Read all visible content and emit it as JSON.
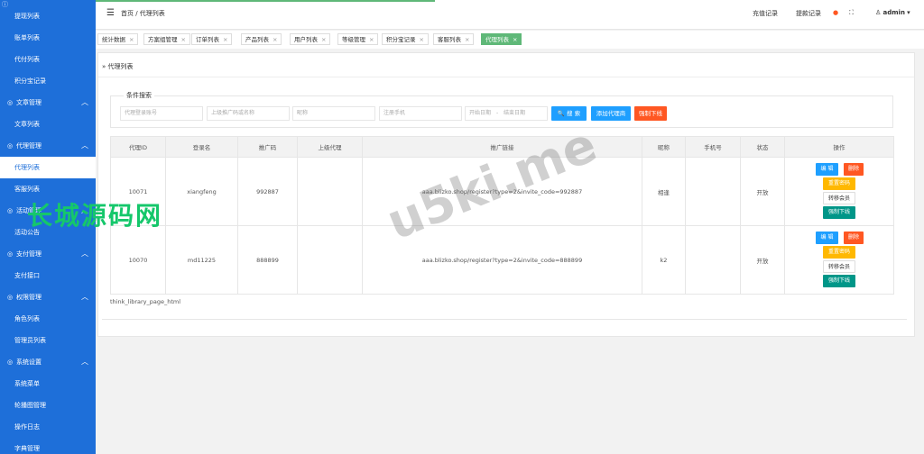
{
  "sidebar": {
    "items": [
      {
        "label": "提现列表",
        "type": "sub"
      },
      {
        "label": "账单列表",
        "type": "sub"
      },
      {
        "label": "代付列表",
        "type": "sub"
      },
      {
        "label": "积分宝记录",
        "type": "sub"
      },
      {
        "label": "文章管理",
        "type": "group",
        "icon": "file-icon"
      },
      {
        "label": "文章列表",
        "type": "sub"
      },
      {
        "label": "代理管理",
        "type": "group",
        "icon": "user-icon"
      },
      {
        "label": "代理列表",
        "type": "sub",
        "active": true
      },
      {
        "label": "客服列表",
        "type": "sub"
      },
      {
        "label": "活动管理",
        "type": "group",
        "icon": "globe-icon"
      },
      {
        "label": "活动公告",
        "type": "sub"
      },
      {
        "label": "支付管理",
        "type": "group",
        "icon": "cart-icon"
      },
      {
        "label": "支付接口",
        "type": "sub"
      },
      {
        "label": "权限管理",
        "type": "group",
        "icon": "shield-icon"
      },
      {
        "label": "角色列表",
        "type": "sub"
      },
      {
        "label": "管理员列表",
        "type": "sub"
      },
      {
        "label": "系统设置",
        "type": "group",
        "icon": "gear-icon"
      },
      {
        "label": "系统菜单",
        "type": "sub"
      },
      {
        "label": "轮播图管理",
        "type": "sub"
      },
      {
        "label": "操作日志",
        "type": "sub"
      },
      {
        "label": "字典管理",
        "type": "sub"
      }
    ]
  },
  "header": {
    "breadcrumb": "首页 / 代理列表",
    "recharge_link": "充值记录",
    "withdraw_link": "提款记录",
    "user": "admin",
    "progress": 0.41
  },
  "tabs": [
    {
      "label": "统计数据"
    },
    {
      "label": "方案组管理"
    },
    {
      "label": "订单列表"
    },
    {
      "label": "产品列表"
    },
    {
      "label": "用户列表"
    },
    {
      "label": "等级管理"
    },
    {
      "label": "积分宝记录"
    },
    {
      "label": "客服列表"
    },
    {
      "label": "代理列表",
      "active": true
    }
  ],
  "page": {
    "sub_crumb": "» 代理列表",
    "search_legend": "条件搜索",
    "placeholders": {
      "account": "代理登录账号",
      "parent": "上级推广码或名称",
      "nickname": "昵称",
      "phone": "注册手机",
      "start_date": "开始日期",
      "date_sep": "-",
      "end_date": "结束日期"
    },
    "buttons": {
      "search": "搜 索",
      "add_agent": "添加代理商",
      "force_offline": "强制下线"
    },
    "table": {
      "headers": [
        "代理ID",
        "登录名",
        "推广码",
        "上级代理",
        "推广链接",
        "昵称",
        "手机号",
        "状态",
        "操作"
      ],
      "rows": [
        {
          "id": "10071",
          "login": "xiangfeng",
          "code": "992887",
          "parent": "",
          "link": "aaa.blizko.shop/register?type=2&invite_code=992887",
          "nickname": "相逢",
          "phone": "",
          "status": "开放"
        },
        {
          "id": "10070",
          "login": "md11225",
          "code": "888899",
          "parent": "",
          "link": "aaa.blizko.shop/register?type=2&invite_code=888899",
          "nickname": "k2",
          "phone": "",
          "status": "开放"
        }
      ],
      "ops": {
        "edit": "编 辑",
        "delete": "删除",
        "reset_password": "重置密码",
        "transfer_member": "转移会员",
        "force_offline": "强制下线"
      }
    },
    "footer_note": "think_library_page_html"
  },
  "watermarks": {
    "cn": "长城源码网",
    "en": "u5ki.me"
  }
}
